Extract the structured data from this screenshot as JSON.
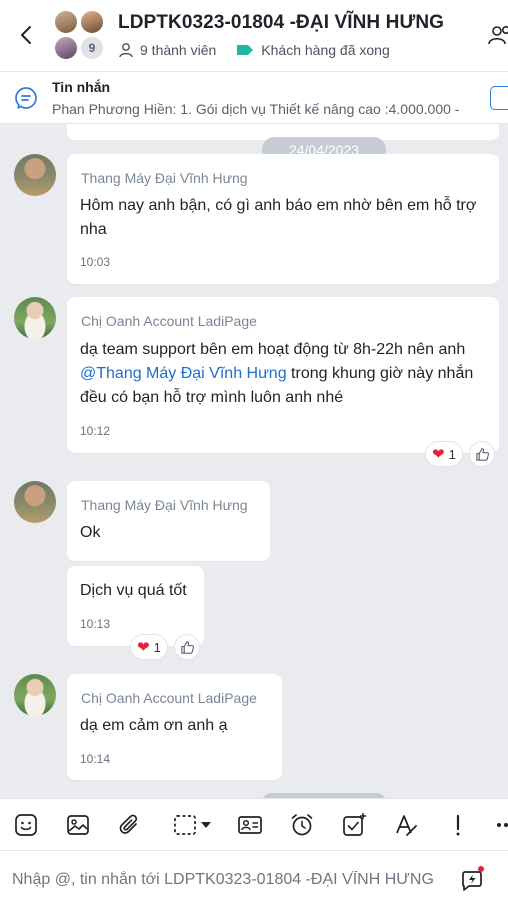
{
  "header": {
    "title": "LDPTK0323-01804 -ĐẠI VĨNH HƯNG",
    "member_count_badge": "9",
    "members_label": "9 thành viên",
    "tag_label": "Khách hàng đã xong",
    "tag_color": "#1fb8a8"
  },
  "pinned": {
    "title": "Tin nhắn",
    "text": "Phan Phương Hiền: 1. Gói dịch vụ Thiết kế nâng cao :4.000.000  - Ph..."
  },
  "chat": {
    "date_separator": "24/04/2023",
    "messages": [
      {
        "sender": "Thang Máy Đại Vĩnh Hưng",
        "text": "Hôm nay anh bận, có gì anh báo em nhờ bên em hỗ trợ nha",
        "time": "10:03"
      },
      {
        "sender": "Chị Oanh Account LadiPage",
        "text_before": "dạ team support bên em hoạt động từ 8h-22h nên anh ",
        "mention": "@Thang Máy Đại Vĩnh Hưng",
        "text_after": " trong khung giờ này nhắn đều có bạn hỗ trợ mình luôn anh nhé",
        "time": "10:12",
        "reaction_count": "1"
      },
      {
        "sender": "Thang Máy Đại Vĩnh Hưng",
        "text": "Ok"
      },
      {
        "text": "Dịch vụ quá tốt",
        "time": "10:13",
        "reaction_count": "1"
      },
      {
        "sender": "Chị Oanh Account LadiPage",
        "text": "dạ em cảm ơn anh ạ",
        "time": "10:14"
      }
    ]
  },
  "toolbar": {
    "icons": [
      "sticker-icon",
      "image-icon",
      "attachment-icon",
      "screenshot-icon",
      "contact-card-icon",
      "reminder-icon",
      "task-icon",
      "format-text-icon",
      "important-icon",
      "more-icon"
    ]
  },
  "input": {
    "placeholder": "Nhập @, tin nhắn tới LDPTK0323-01804 -ĐẠI VĨNH HƯNG"
  }
}
